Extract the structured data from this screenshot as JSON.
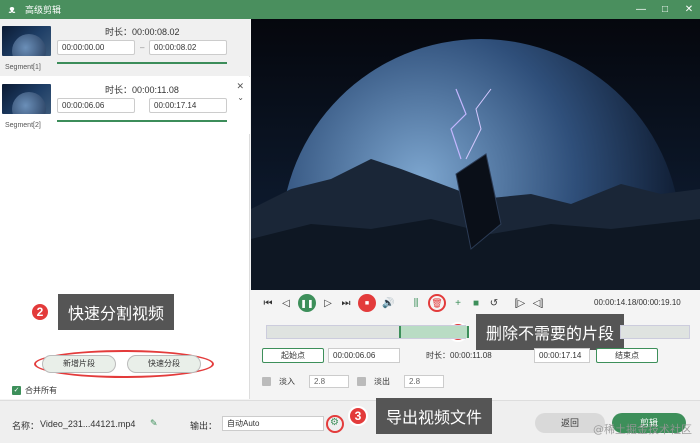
{
  "app": {
    "title": "高级剪辑",
    "logo": "bunny-logo"
  },
  "window_buttons": [
    "—",
    "□",
    "✕"
  ],
  "segments": [
    {
      "label": "Segment[1]",
      "duration": "时长：00:00:08.02",
      "start": "00:00:00.00",
      "end": "00:00:08.02",
      "separator": "–"
    },
    {
      "label": "Segment[2]",
      "duration": "时长：00:00:11.08",
      "start": "00:00:06.06",
      "end": "00:00:17.14"
    }
  ],
  "left_buttons": {
    "new_segment": "新增片段",
    "quick_split": "快速分段"
  },
  "merge_all": "合并所有",
  "player": {
    "timecode": "00:00:14.18/00:00:19.10"
  },
  "trim": {
    "start_label": "起始点",
    "start_value": "00:00:06.06",
    "duration_label": "时长：00:00:11.08",
    "end_value": "00:00:17.14",
    "end_label": "结束点"
  },
  "fade": {
    "in_label": "淡入",
    "in_value": "2.8",
    "out_label": "淡出",
    "out_value": "2.8"
  },
  "bottom": {
    "name_label": "名称：",
    "name_value": "Video_231...44121.mp4",
    "output_label": "输出：",
    "output_value": "自动Auto",
    "back": "返回",
    "cut": "剪辑"
  },
  "callouts": {
    "c1": {
      "num": "1",
      "text": "删除不需要的片段"
    },
    "c2": {
      "num": "2",
      "text": "快速分割视频"
    },
    "c3": {
      "num": "3",
      "text": "导出视频文件"
    }
  },
  "watermark": "@稀土掘金技术社区",
  "colors": {
    "brand": "#4a8f5e",
    "accent": "#3d8f5a",
    "danger": "#e33b3b"
  }
}
